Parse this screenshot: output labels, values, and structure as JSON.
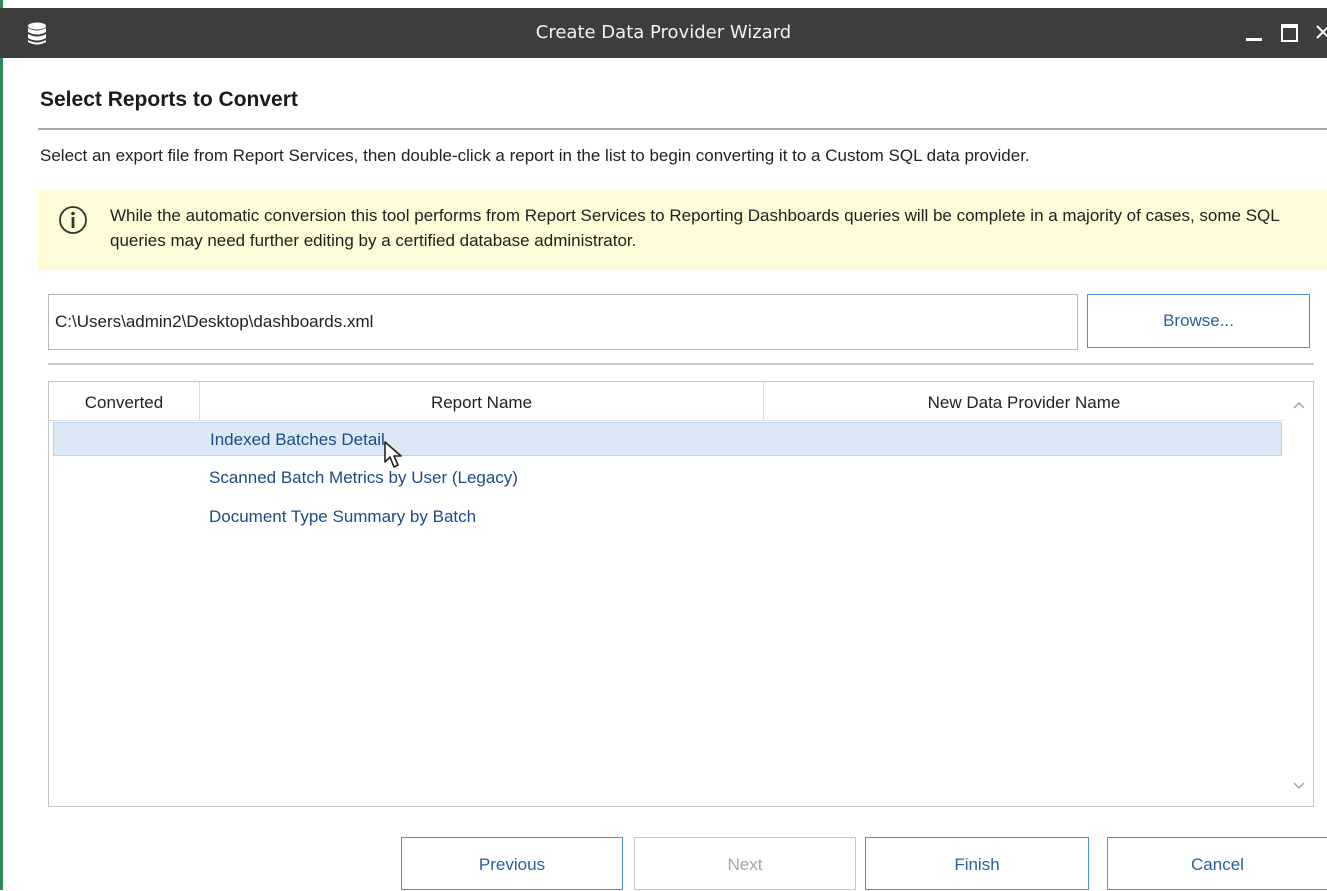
{
  "window": {
    "title": "Create Data Provider Wizard",
    "app_icon": "database-icon",
    "controls": [
      "minimize-icon",
      "maximize-icon",
      "close-icon"
    ]
  },
  "page": {
    "heading": "Select Reports to Convert",
    "instructions": "Select an export file from Report Services, then double-click a report in the list to begin converting it to a Custom SQL data provider."
  },
  "info": {
    "icon": "info-icon",
    "text": "While the automatic conversion this tool performs from Report Services to Reporting Dashboards queries will be complete in a majority of cases, some SQL queries may need further editing by a certified database administrator."
  },
  "file": {
    "path": "C:\\Users\\admin2\\Desktop\\dashboards.xml",
    "browse_label": "Browse..."
  },
  "table": {
    "columns": [
      "Converted",
      "Report Name",
      "New Data Provider Name"
    ],
    "rows": [
      {
        "converted": "",
        "report_name": "Indexed Batches Detail",
        "new_name": "",
        "selected": true
      },
      {
        "converted": "",
        "report_name": "Scanned Batch Metrics by User (Legacy)",
        "new_name": "",
        "selected": false
      },
      {
        "converted": "",
        "report_name": "Document Type Summary by Batch",
        "new_name": "",
        "selected": false
      }
    ]
  },
  "buttons": {
    "previous": "Previous",
    "next": "Next",
    "finish": "Finish",
    "cancel": "Cancel"
  },
  "colors": {
    "titlebar": "#3d3d3d",
    "info_background": "#fdfbd8",
    "accent_blue": "#4a90d9",
    "link_text": "#1e4a8a",
    "selection": "#dbe9f7"
  }
}
